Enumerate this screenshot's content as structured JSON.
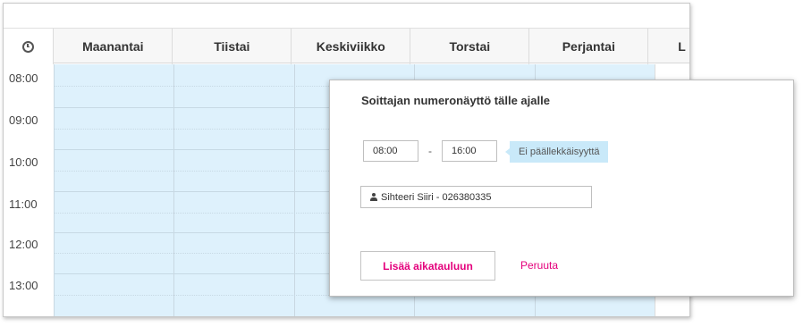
{
  "calendar": {
    "days": [
      "Maanantai",
      "Tiistai",
      "Keskiviikko",
      "Torstai",
      "Perjantai",
      "L"
    ],
    "times": [
      "08:00",
      "09:00",
      "10:00",
      "11:00",
      "12:00",
      "13:00"
    ]
  },
  "popup": {
    "title": "Soittajan numeronäyttö tälle ajalle",
    "start_time": "08:00",
    "separator": "-",
    "end_time": "16:00",
    "overlap_note": "Ei päällekkäisyyttä",
    "caller": "Sihteeri Siiri - 026380335",
    "add_button": "Lisää aikatauluun",
    "cancel_link": "Peruuta"
  },
  "colors": {
    "accent": "#e4007c",
    "selection": "#def1fc",
    "tooltip": "#c9e9f9"
  },
  "icons": [
    "clock-icon",
    "person-icon"
  ]
}
